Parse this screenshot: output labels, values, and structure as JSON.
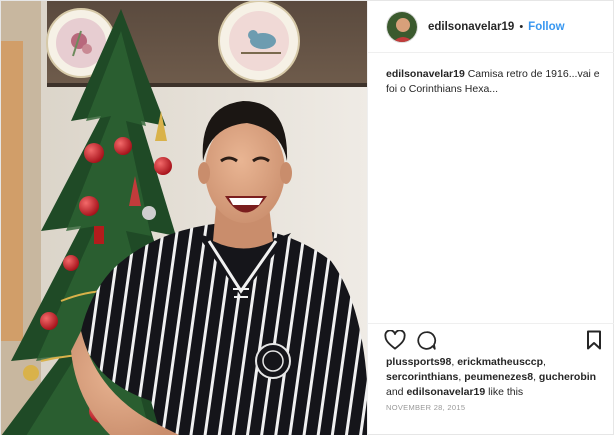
{
  "header": {
    "username": "edilsonavelar19",
    "separator": "•",
    "follow_label": "Follow"
  },
  "caption": {
    "username": "edilsonavelar19",
    "text": "Camisa retro de 1916...vai e foi o Corinthians Hexa..."
  },
  "actions": {
    "icons": [
      "heart-icon",
      "comment-icon",
      "bookmark-icon"
    ]
  },
  "likes": {
    "users": [
      "plussports98",
      "erickmatheusccp",
      "sercorinthians",
      "peumenezes8",
      "gucherobin",
      "edilsonavelar19"
    ],
    "sep1": ", ",
    "sep2": ", ",
    "sep3": ", ",
    "sep4": ", ",
    "and_text": " and ",
    "suffix": " like this"
  },
  "date": "NOVEMBER 28, 2015",
  "colors": {
    "follow": "#3897f0",
    "text": "#262626",
    "muted": "#999999",
    "divider": "#efefef"
  }
}
